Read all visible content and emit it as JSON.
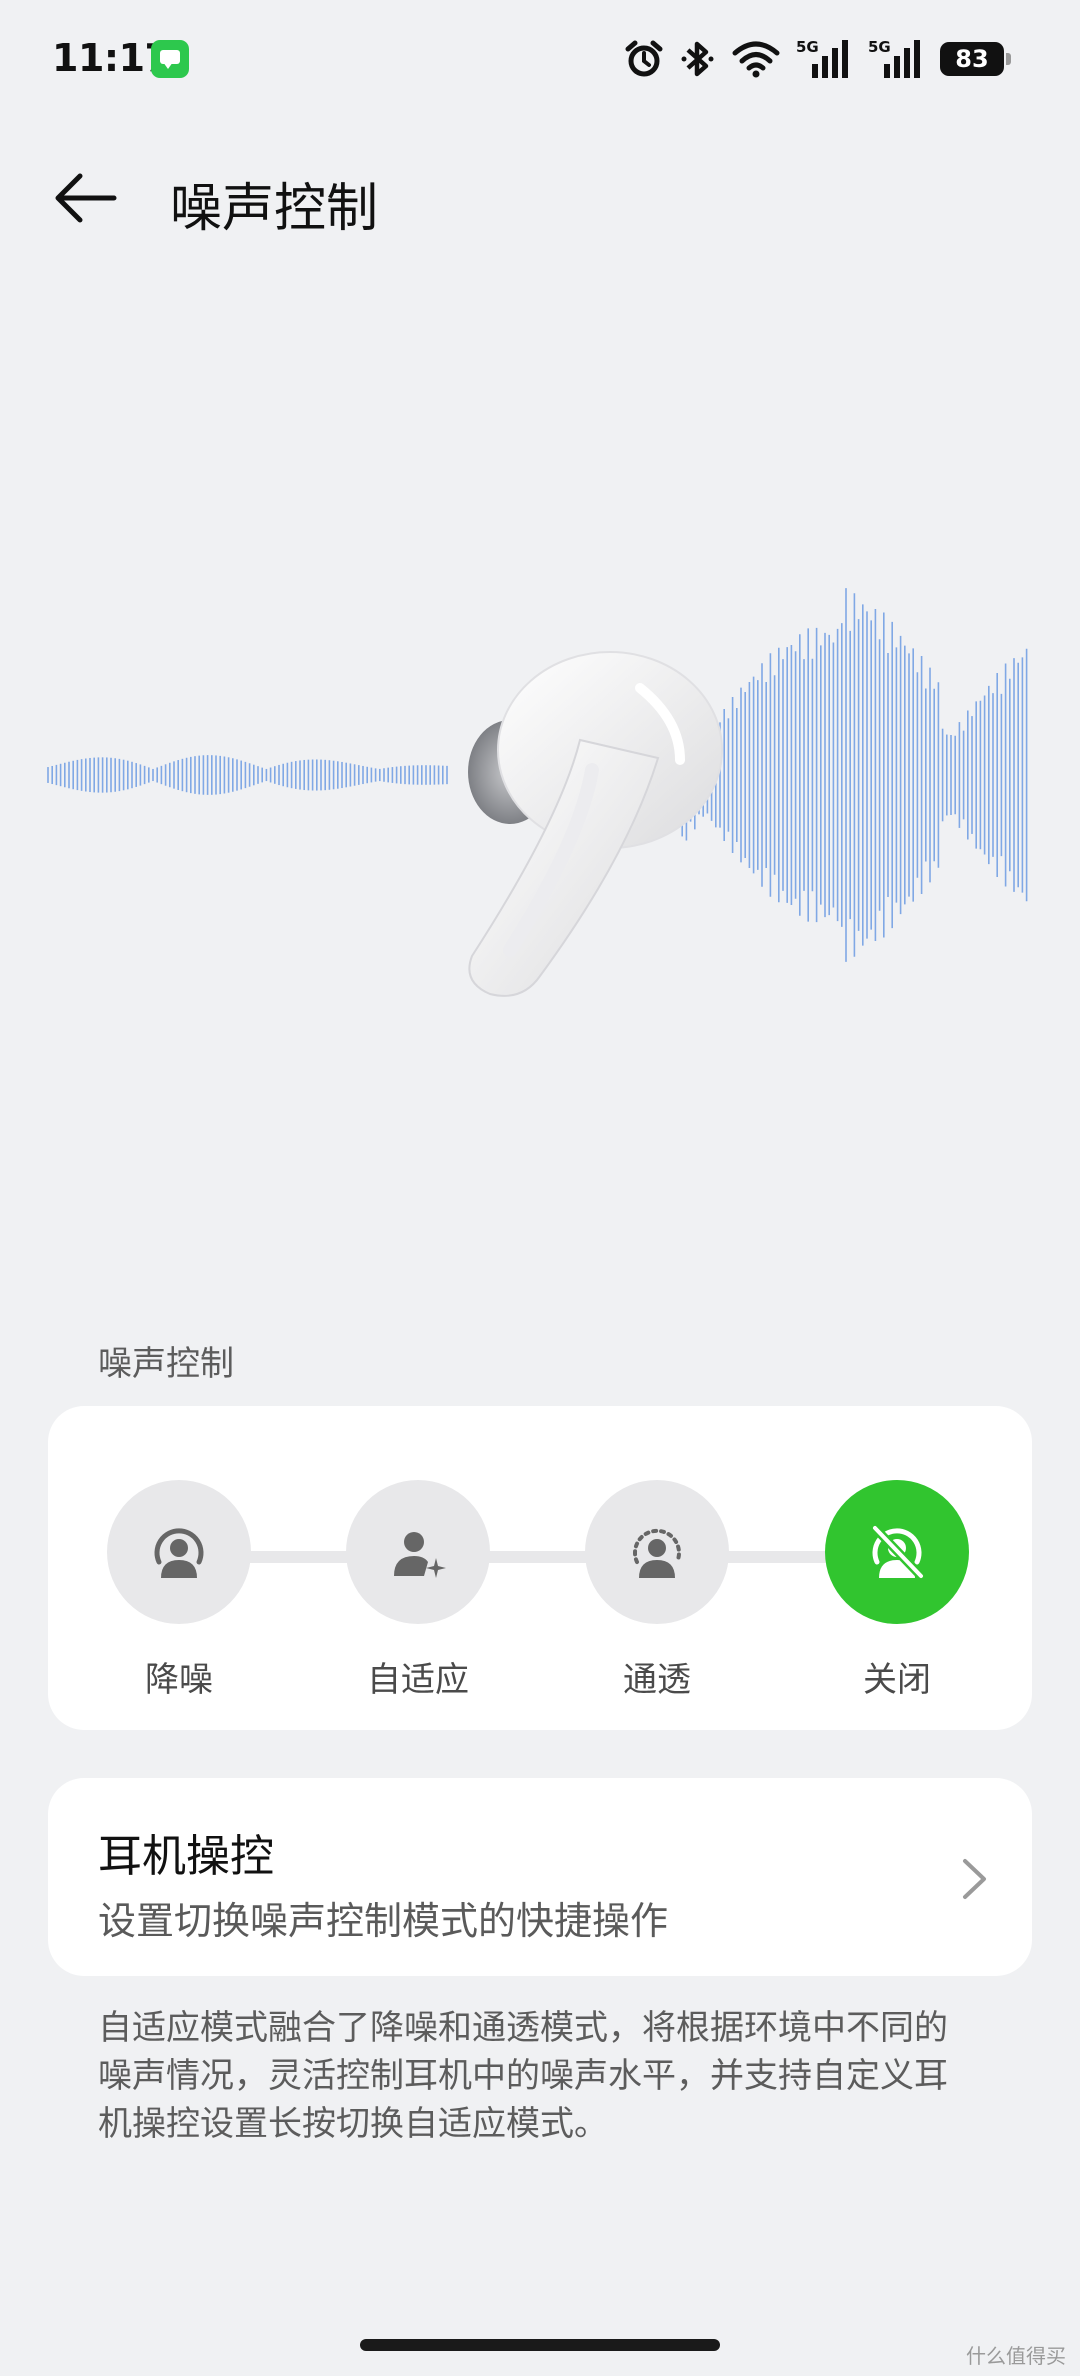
{
  "status_bar": {
    "time": "11:17",
    "battery": "83",
    "network_labels": [
      "5G",
      "5G"
    ],
    "icons": [
      "message-app-icon",
      "alarm-icon",
      "bluetooth-icon",
      "wifi-icon",
      "signal-icon",
      "signal-icon",
      "battery-icon"
    ]
  },
  "header": {
    "title": "噪声控制",
    "back_icon": "back-arrow-icon"
  },
  "hero": {
    "image": "earbud-illustration",
    "wave_color": "#5b8fe0"
  },
  "noise_control": {
    "section_label": "噪声控制",
    "active_color": "#31c52f",
    "modes": [
      {
        "label": "降噪",
        "icon": "noise-cancel-icon",
        "active": false
      },
      {
        "label": "自适应",
        "icon": "adaptive-icon",
        "active": false
      },
      {
        "label": "通透",
        "icon": "transparency-icon",
        "active": false
      },
      {
        "label": "关闭",
        "icon": "noise-off-icon",
        "active": true
      }
    ]
  },
  "earphone_control": {
    "title": "耳机操控",
    "subtitle": "设置切换噪声控制模式的快捷操作"
  },
  "note": "自适应模式融合了降噪和通透模式，将根据环境中不同的噪声情况，灵活控制耳机中的噪声水平，并支持自定义耳机操控设置长按切换自适应模式。",
  "watermark": "什么值得买"
}
